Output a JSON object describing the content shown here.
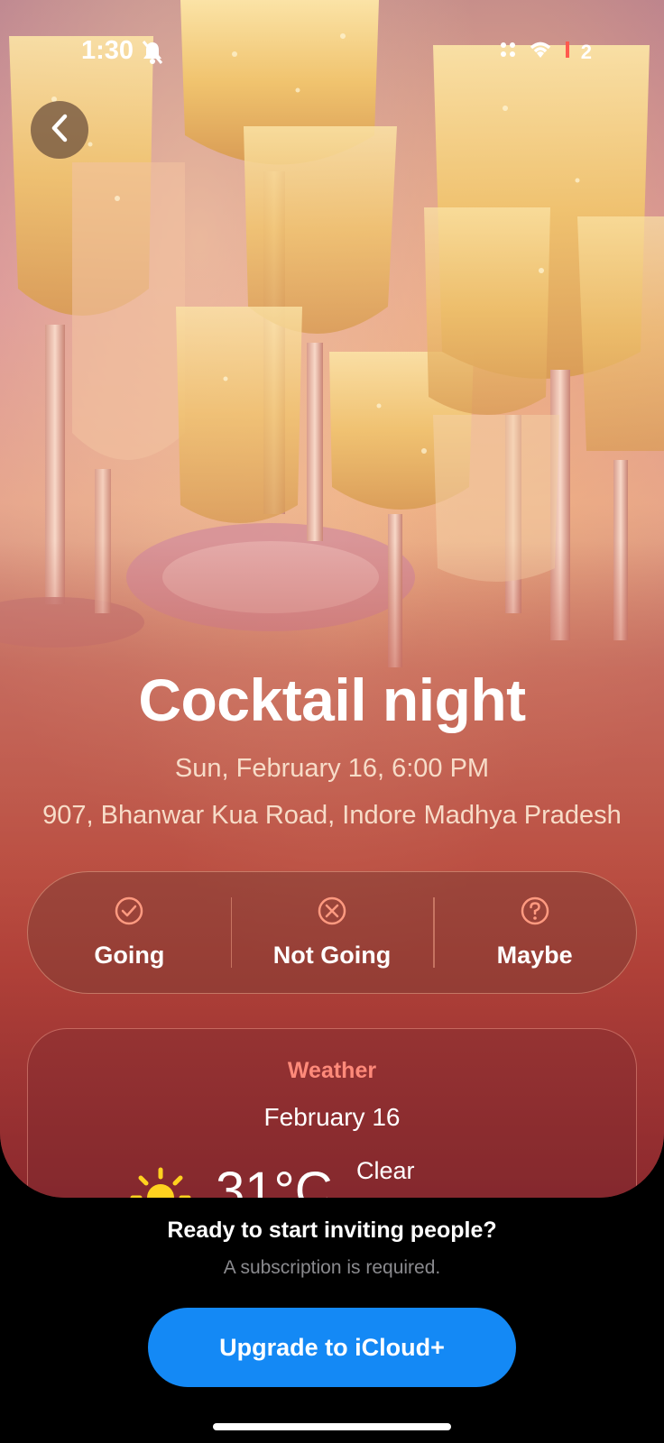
{
  "status_bar": {
    "time": "1:30",
    "badge": "2"
  },
  "event": {
    "title": "Cocktail night",
    "datetime": "Sun, February 16, 6:00 PM",
    "address": "907, Bhanwar Kua Road, Indore Madhya Pradesh"
  },
  "rsvp": {
    "going": "Going",
    "not_going": "Not Going",
    "maybe": "Maybe"
  },
  "weather": {
    "heading": "Weather",
    "date": "February 16",
    "temperature": "31°C",
    "condition": "Clear"
  },
  "invite": {
    "title": "Ready to start inviting people?",
    "subtitle": "A subscription is required.",
    "button_label": "Upgrade to iCloud+"
  },
  "colors": {
    "accent_blue": "#1489f5",
    "rsvp_icon": "#ff9a80",
    "weather_heading": "#ff8a7a",
    "sun": "#ffd21f"
  },
  "icons": {
    "back": "chevron-left-icon",
    "going": "checkmark-circle-icon",
    "not_going": "xmark-circle-icon",
    "maybe": "question-circle-icon",
    "weather": "sun-icon",
    "bell": "bell-slash-icon",
    "wifi": "wifi-icon"
  }
}
